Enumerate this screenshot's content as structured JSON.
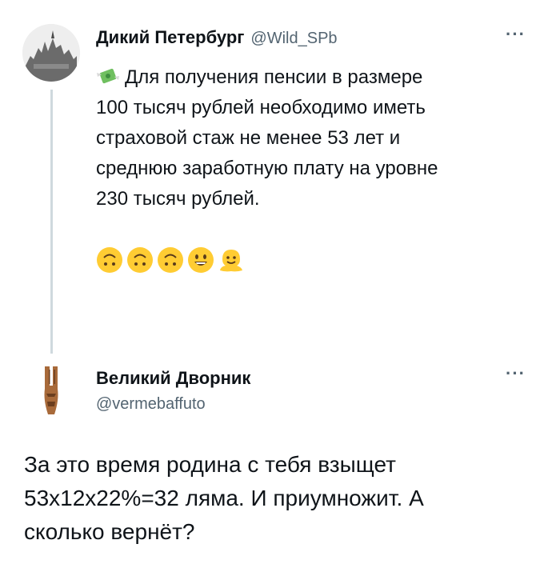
{
  "tweet": {
    "author_name": "Дикий Петербург",
    "author_handle": "@Wild_SPb",
    "line1": "Для получения пенсии в размере",
    "line2": "100 тысяч рублей необходимо иметь",
    "line3": "страховой стаж не менее 53 лет и",
    "line4": "среднюю заработную плату на уровне",
    "line5": "230 тысяч рублей.",
    "leading_emoji": "money-with-wings-icon",
    "emoji_row": [
      "upside-down-face",
      "upside-down-face",
      "upside-down-face",
      "grinning-face",
      "melting-face"
    ]
  },
  "reply": {
    "author_name": "Великий Дворник",
    "author_handle": "@vermebaffuto",
    "line1": "За это время родина с тебя взыщет",
    "line2": "53x12x22%=32 ляма. И приумножит. А",
    "line3": "сколько вернёт?"
  },
  "more_label": "···",
  "colors": {
    "text": "#0f1419",
    "secondary": "#536471",
    "thread_line": "#cfd9de",
    "emoji_yellow": "#ffcc33"
  }
}
